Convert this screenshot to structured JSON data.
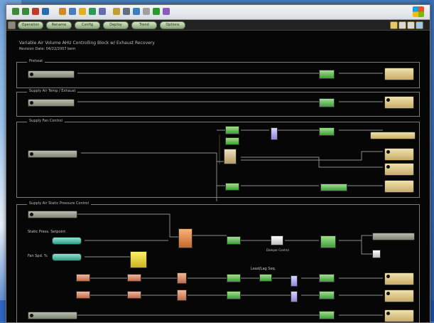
{
  "toolbar": {
    "icons": [
      "back-icon",
      "forward-icon",
      "stop-icon",
      "refresh-icon",
      "home-icon",
      "search-icon",
      "favorites-icon",
      "media-icon",
      "history-icon",
      "mail-icon",
      "print-icon",
      "edit-icon",
      "discuss-icon",
      "messenger-icon",
      "research-icon"
    ]
  },
  "app": {
    "menu": [
      "Operation",
      "Rename",
      "Config",
      "Deploy",
      "Trend",
      "Options"
    ],
    "header_line1": "Variable Air Volume AHU Controlling Block w/ Exhaust Recovery",
    "header_line2": "Revision Date: 04/22/2007 bem"
  },
  "panels": {
    "p1_title": "Preheat",
    "p2_title": "Supply Air Temp / Exhaust",
    "p3_title": "Supply Fan Control",
    "p4_title": "Supply Air Static Pressure Control"
  },
  "labels": {
    "static_press_setpoint": "Static Press. Setpoint",
    "fan_spd": "Fan Spd. %",
    "lead_lag": "Lead/Lag Seq.",
    "damper_ctrl": "Damper Control"
  },
  "colors": {
    "input": "#9aa08f",
    "logic": "#5fbf55",
    "output": "#dcc791",
    "pid": "#e08a4c",
    "timer": "#e6d340",
    "compare": "#aaa4f0"
  }
}
